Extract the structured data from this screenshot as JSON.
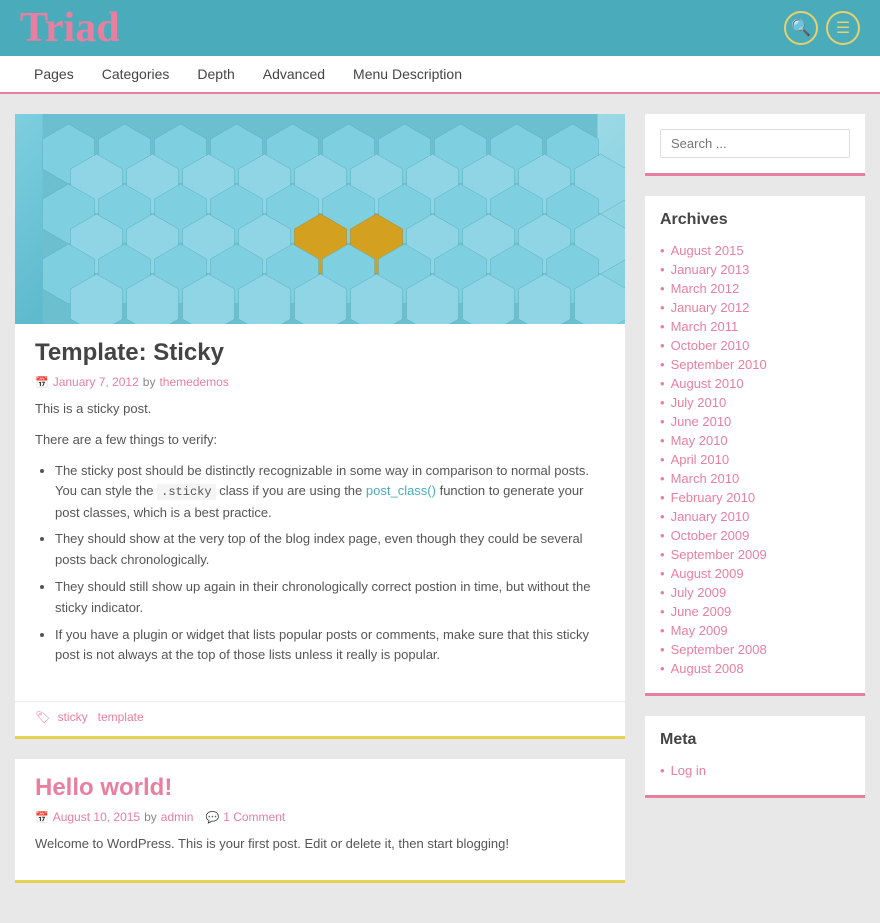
{
  "site": {
    "title": "Triad"
  },
  "header": {
    "search_icon": "🔍",
    "menu_icon": "☰"
  },
  "nav": {
    "items": [
      {
        "label": "Pages"
      },
      {
        "label": "Categories"
      },
      {
        "label": "Depth"
      },
      {
        "label": "Advanced"
      },
      {
        "label": "Menu Description"
      }
    ]
  },
  "sidebar": {
    "search_placeholder": "Search ...",
    "archives_title": "Archives",
    "archives": [
      {
        "label": "August 2015",
        "href": "#"
      },
      {
        "label": "January 2013",
        "href": "#"
      },
      {
        "label": "March 2012",
        "href": "#"
      },
      {
        "label": "January 2012",
        "href": "#"
      },
      {
        "label": "March 2011",
        "href": "#"
      },
      {
        "label": "October 2010",
        "href": "#"
      },
      {
        "label": "September 2010",
        "href": "#"
      },
      {
        "label": "August 2010",
        "href": "#"
      },
      {
        "label": "July 2010",
        "href": "#"
      },
      {
        "label": "June 2010",
        "href": "#"
      },
      {
        "label": "May 2010",
        "href": "#"
      },
      {
        "label": "April 2010",
        "href": "#"
      },
      {
        "label": "March 2010",
        "href": "#"
      },
      {
        "label": "February 2010",
        "href": "#"
      },
      {
        "label": "January 2010",
        "href": "#"
      },
      {
        "label": "October 2009",
        "href": "#"
      },
      {
        "label": "September 2009",
        "href": "#"
      },
      {
        "label": "August 2009",
        "href": "#"
      },
      {
        "label": "July 2009",
        "href": "#"
      },
      {
        "label": "June 2009",
        "href": "#"
      },
      {
        "label": "May 2009",
        "href": "#"
      },
      {
        "label": "September 2008",
        "href": "#"
      },
      {
        "label": "August 2008",
        "href": "#"
      }
    ],
    "meta_title": "Meta",
    "meta_items": [
      {
        "label": "Log in",
        "href": "#"
      }
    ]
  },
  "posts": [
    {
      "id": "sticky",
      "title": "Template: Sticky",
      "title_color": "#444",
      "date": "January 7, 2012",
      "author": "themedemos",
      "intro": "This is a sticky post.",
      "subtext": "There are a few things to verify:",
      "bullets": [
        "The sticky post should be distinctly recognizable in some way in comparison to normal posts. You can style the .sticky class if you are using the post_class() function to generate your post classes, which is a best practice.",
        "They should show at the very top of the blog index page, even though they could be several posts back chronologically.",
        "They should still show up again in their chronologically correct postion in time, but without the sticky indicator.",
        "If you have a plugin or widget that lists popular posts or comments, make sure that this sticky post is not always at the top of those lists unless it really is popular."
      ],
      "tags": [
        "sticky",
        "template"
      ]
    },
    {
      "id": "hello-world",
      "title": "Hello world!",
      "title_color": "#e87fa0",
      "date": "August 10, 2015",
      "author": "admin",
      "comment_count": "1 Comment",
      "body": "Welcome to WordPress. This is your first post. Edit or delete it, then start blogging!"
    }
  ]
}
